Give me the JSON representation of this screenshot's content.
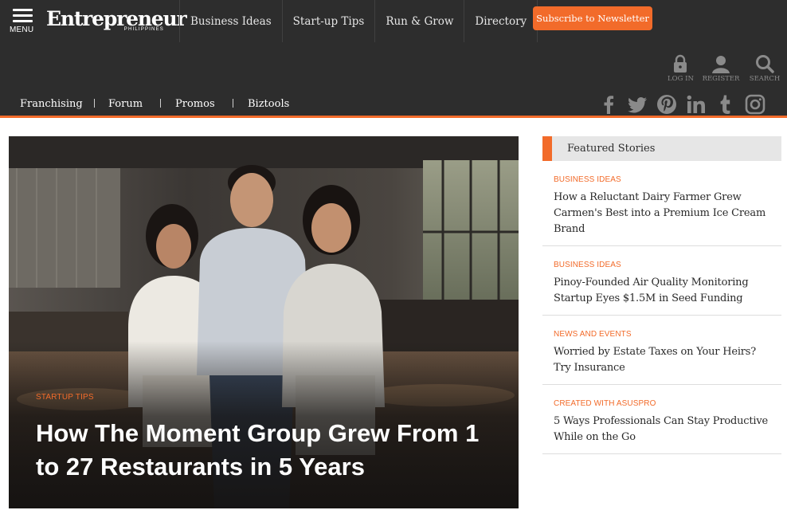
{
  "header": {
    "menu_label": "MENU",
    "logo_text": "Entrepreneur",
    "logo_subtext": "PHILIPPINES",
    "nav": [
      "Business Ideas",
      "Start-up Tips",
      "Run & Grow",
      "Directory"
    ],
    "subscribe_label": "Subscribe to Newsletter",
    "login_label": "LOG IN",
    "register_label": "REGISTER",
    "search_label": "SEARCH",
    "icons": [
      "menu-icon",
      "lock-icon",
      "user-icon",
      "search-icon"
    ]
  },
  "subnav": {
    "items": [
      "Franchising",
      "Forum",
      "Promos",
      "Biztools"
    ],
    "social_icons": [
      "facebook-icon",
      "twitter-icon",
      "pinterest-icon",
      "linkedin-icon",
      "tumblr-icon",
      "instagram-icon"
    ]
  },
  "hero": {
    "category": "STARTUP TIPS",
    "title": "How The Moment Group Grew From 1 to 27 Restaurants in 5 Years"
  },
  "featured": {
    "heading": "Featured Stories",
    "stories": [
      {
        "category": "BUSINESS IDEAS",
        "title": "How a Reluctant Dairy Farmer Grew Carmen's Best into a Premium Ice Cream Brand"
      },
      {
        "category": "BUSINESS IDEAS",
        "title": "Pinoy-Founded Air Quality Monitoring Startup Eyes $1.5M in Seed Funding"
      },
      {
        "category": "NEWS AND EVENTS",
        "title": "Worried by Estate Taxes on Your Heirs? Try Insurance"
      },
      {
        "category": "CREATED WITH ASUSPRO",
        "title": "5 Ways Professionals Can Stay Productive While on the Go"
      }
    ]
  },
  "colors": {
    "header_bg": "#2d2d2d",
    "accent": "#f26b2a",
    "featured_header_bg": "#e6e6e6",
    "body_text": "#2a2a2a"
  }
}
